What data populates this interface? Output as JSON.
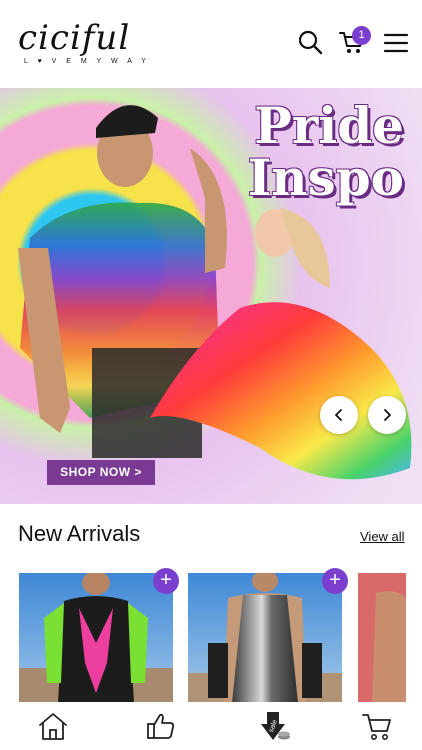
{
  "brand": {
    "logo_text": "ciciful",
    "tagline": "L ♥ V E  M Y  W A Y"
  },
  "header": {
    "cart_count": "1",
    "icons": [
      "search-icon",
      "cart-icon",
      "hamburger-menu-icon"
    ],
    "accent_color": "#7b3fd0"
  },
  "hero": {
    "title_line1": "Pride",
    "title_line2": "Inspo",
    "cta_label": "SHOP NOW >",
    "prev_label": "‹",
    "next_label": "›"
  },
  "new_arrivals": {
    "title": "New Arrivals",
    "view_all_label": "View all",
    "add_label": "+",
    "products": [
      {
        "name": "neon-pink-green-bodysuit"
      },
      {
        "name": "metallic-silver-bodysuit"
      },
      {
        "name": "partial-product"
      }
    ]
  },
  "bottom_nav": {
    "items": [
      "home-icon",
      "thumbs-up-icon",
      "sale-icon",
      "cart-icon"
    ],
    "sale_text": "sale"
  }
}
